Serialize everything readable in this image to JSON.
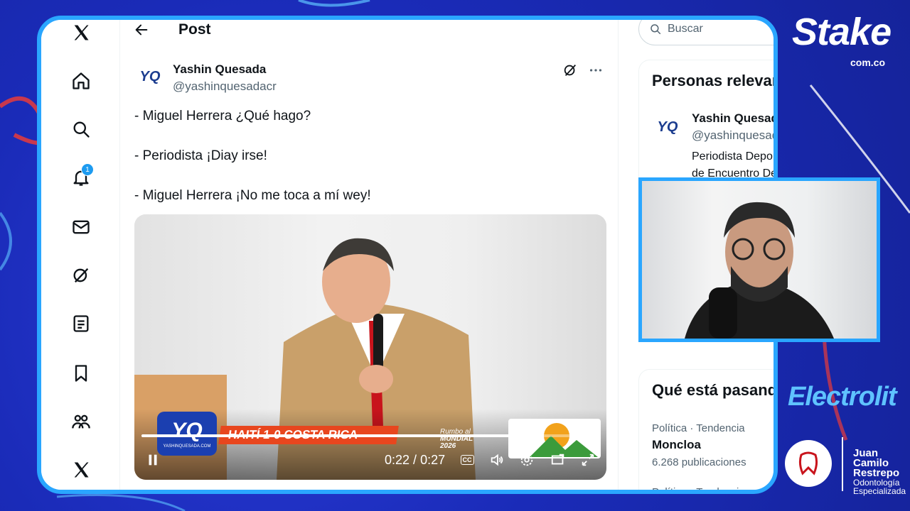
{
  "nav": {
    "notifications_count": "1"
  },
  "post": {
    "header_title": "Post",
    "author_name": "Yashin Quesada",
    "author_handle": "@yashinquesadacr",
    "avatar_text": "YQ",
    "lines": [
      "- Miguel Herrera ¿Qué hago?",
      "- Periodista ¡Diay irse!",
      "- Miguel Herrera ¡No me toca a mí wey!"
    ]
  },
  "video": {
    "lower_third_logo": "YQ",
    "lower_third_logo_sub": "YASHINQUESADA.COM",
    "banner_text": "HAITÍ 1-0 COSTA RICA",
    "sub_logo_line1": "Rumbo al",
    "sub_logo_line2": "MUNDIAL",
    "sub_logo_line3": "2026",
    "time_current": "0:22",
    "time_total": "0:27",
    "cc_label": "CC",
    "progress_fraction": 0.8148
  },
  "search": {
    "placeholder": "Buscar"
  },
  "relevant": {
    "title": "Personas relevantes",
    "name": "Yashin Quesada",
    "handle": "@yashinquesadacr",
    "bio_line1": "Periodista Deportivo",
    "bio_line2": "de Encuentro Deportivo"
  },
  "trends": {
    "title": "Qué está pasando",
    "items": [
      {
        "meta": "Política · Tendencia",
        "name": "Moncloa",
        "count": "6.268 publicaciones"
      },
      {
        "meta": "Política · Tendencia",
        "name": "",
        "count": ""
      }
    ]
  },
  "sponsors": {
    "stake": "Stake",
    "stake_sub": "com.co",
    "electrolit": "Electrolit",
    "dent_line1": "Juan Camilo",
    "dent_line2": "Restrepo",
    "dent_line3": "Odontología",
    "dent_line4": "Especializada"
  },
  "colors": {
    "frame_border": "#2aa6ff",
    "twitter_blue": "#1d9bf0",
    "banner_orange": "#e8461e",
    "background_blue": "#1a2bb8"
  }
}
